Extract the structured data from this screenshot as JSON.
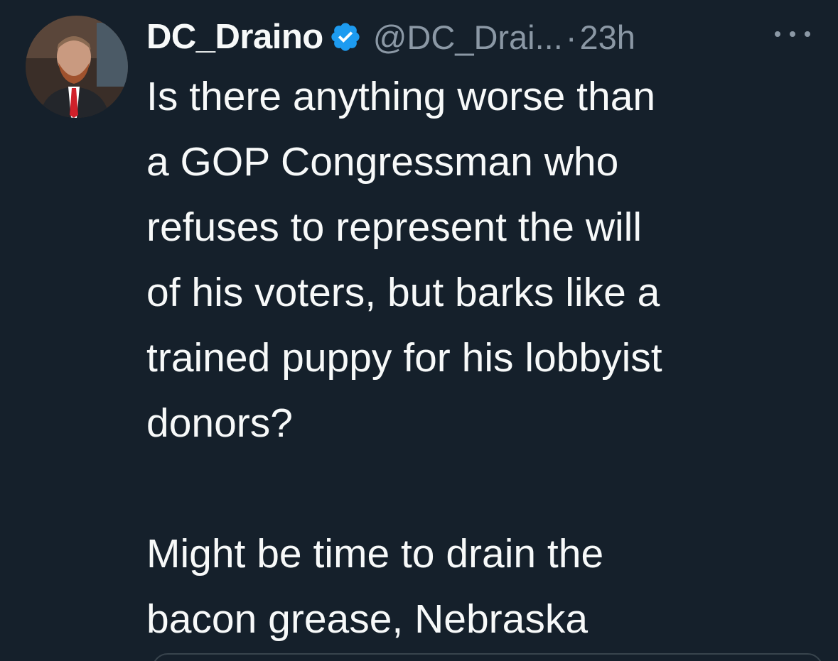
{
  "tweet": {
    "display_name": "DC_Draino",
    "handle": "@DC_Drai...",
    "separator": "·",
    "time": "23h",
    "paragraphs": [
      "Is there anything worse than\na GOP Congressman who\nrefuses to represent the will\nof his voters, but barks like a\ntrained puppy for his lobbyist\ndonors?",
      "Might be time to drain the\nbacon grease, Nebraska"
    ]
  },
  "icons": {
    "verified": "verified-badge-icon",
    "more": "more-options-icon"
  },
  "colors": {
    "background": "#15202b",
    "text": "#f7f9f9",
    "secondary": "#8b98a5",
    "verified": "#1d9bf0"
  }
}
